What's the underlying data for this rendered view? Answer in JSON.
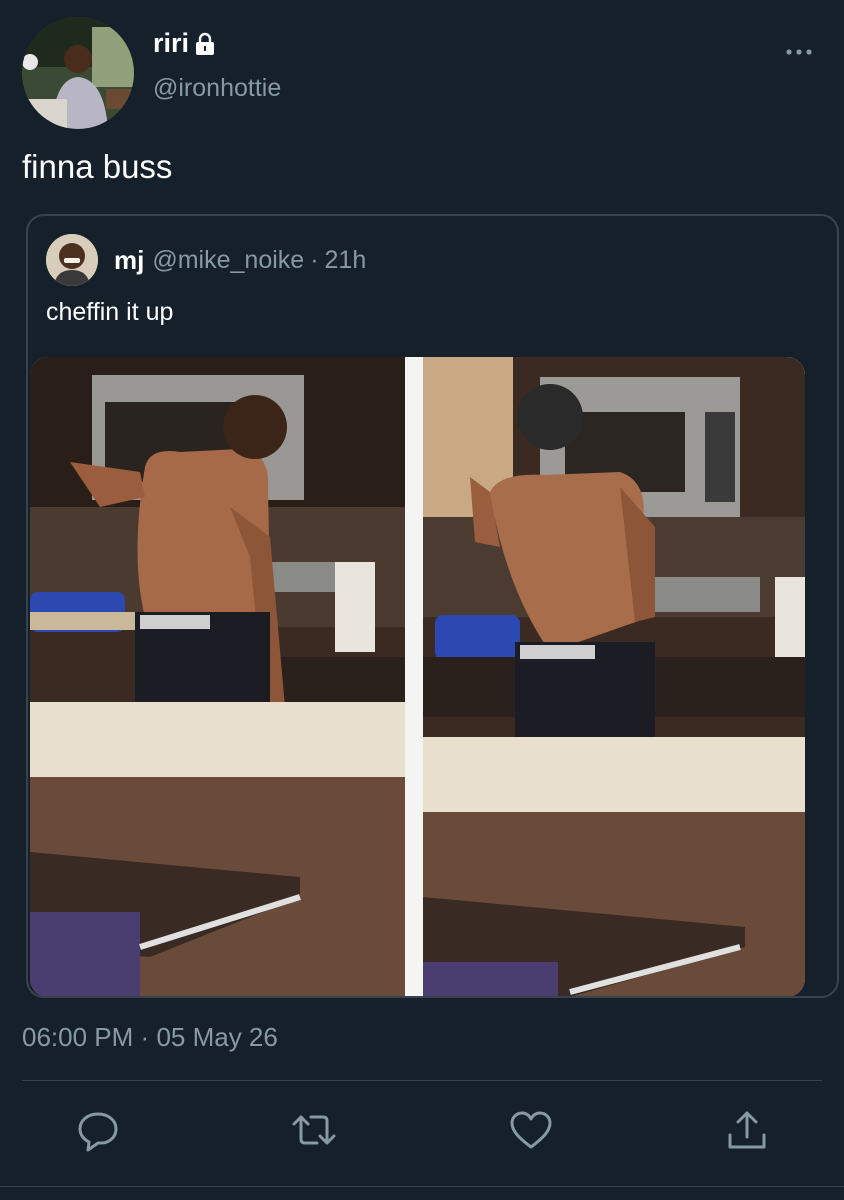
{
  "author": {
    "display_name": "riri",
    "handle": "@ironhottie",
    "avatar_icon": "profile-photo",
    "locked_icon": "lock-icon"
  },
  "tweet": {
    "text": "finna buss",
    "timestamp": "06:00 PM",
    "separator": "·",
    "date": "05 May 26"
  },
  "quoted": {
    "display_name": "mj",
    "handle": "@mike_noike",
    "separator": "·",
    "time": "21h",
    "text": "cheffin it up",
    "media_icon": "photo-collage"
  },
  "actions": {
    "reply_icon": "reply-icon",
    "retweet_icon": "retweet-icon",
    "like_icon": "heart-icon",
    "share_icon": "share-icon"
  },
  "colors": {
    "background": "#15202b",
    "secondary_text": "#8899a6",
    "border": "#38444d"
  }
}
